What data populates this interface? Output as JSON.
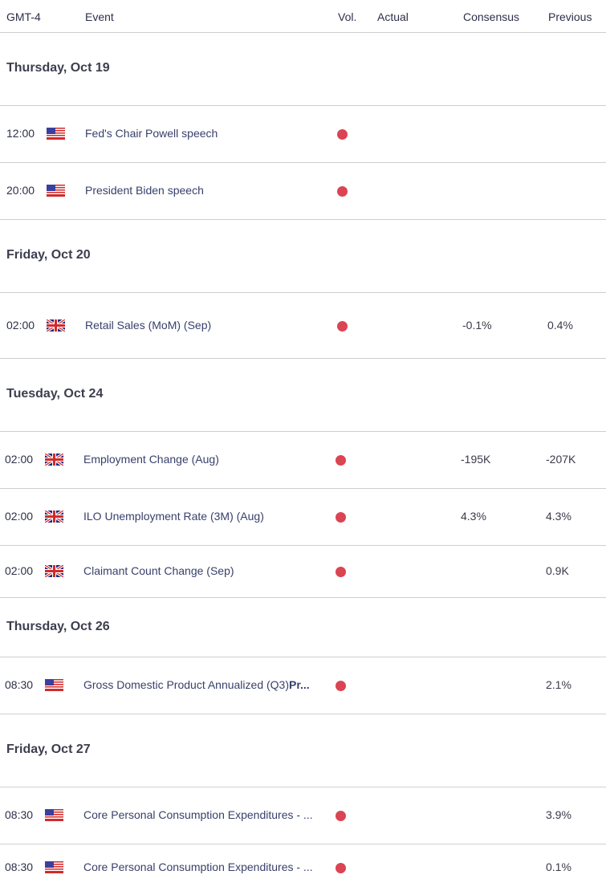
{
  "header": {
    "timezone": "GMT-4",
    "event": "Event",
    "vol": "Vol.",
    "actual": "Actual",
    "consensus": "Consensus",
    "previous": "Previous"
  },
  "colors": {
    "volatility_high": "#db4452"
  },
  "days": [
    {
      "label": "Thursday, Oct 19",
      "events": [
        {
          "time": "12:00",
          "country": "us-flag",
          "event": "Fed's Chair Powell speech",
          "actual": "",
          "consensus": "",
          "previous": ""
        },
        {
          "time": "20:00",
          "country": "us-flag",
          "event": "President Biden speech",
          "actual": "",
          "consensus": "",
          "previous": ""
        }
      ]
    },
    {
      "label": "Friday, Oct 20",
      "events": [
        {
          "time": "02:00",
          "country": "uk-flag",
          "event": "Retail Sales (MoM) (Sep)",
          "actual": "",
          "consensus": "-0.1%",
          "previous": "0.4%"
        }
      ]
    },
    {
      "label": "Tuesday, Oct 24",
      "events": [
        {
          "time": "02:00",
          "country": "uk-flag",
          "event": "Employment Change (Aug)",
          "actual": "",
          "consensus": "-195K",
          "previous": "-207K"
        },
        {
          "time": "02:00",
          "country": "uk-flag",
          "event": "ILO Unemployment Rate (3M) (Aug)",
          "actual": "",
          "consensus": "4.3%",
          "previous": "4.3%"
        },
        {
          "time": "02:00",
          "country": "uk-flag",
          "event": "Claimant Count Change (Sep)",
          "actual": "",
          "consensus": "",
          "previous": "0.9K"
        }
      ]
    },
    {
      "label": "Thursday, Oct 26",
      "events": [
        {
          "time": "08:30",
          "country": "us-flag",
          "event": "Gross Domestic Product Annualized (Q3)",
          "event_suffix": "Pr...",
          "actual": "",
          "consensus": "",
          "previous": "2.1%"
        }
      ]
    },
    {
      "label": "Friday, Oct 27",
      "events": [
        {
          "time": "08:30",
          "country": "us-flag",
          "event": "Core Personal Consumption Expenditures - ...",
          "actual": "",
          "consensus": "",
          "previous": "3.9%"
        },
        {
          "time": "08:30",
          "country": "us-flag",
          "event": "Core Personal Consumption Expenditures - ...",
          "actual": "",
          "consensus": "",
          "previous": "0.1%"
        }
      ]
    }
  ]
}
